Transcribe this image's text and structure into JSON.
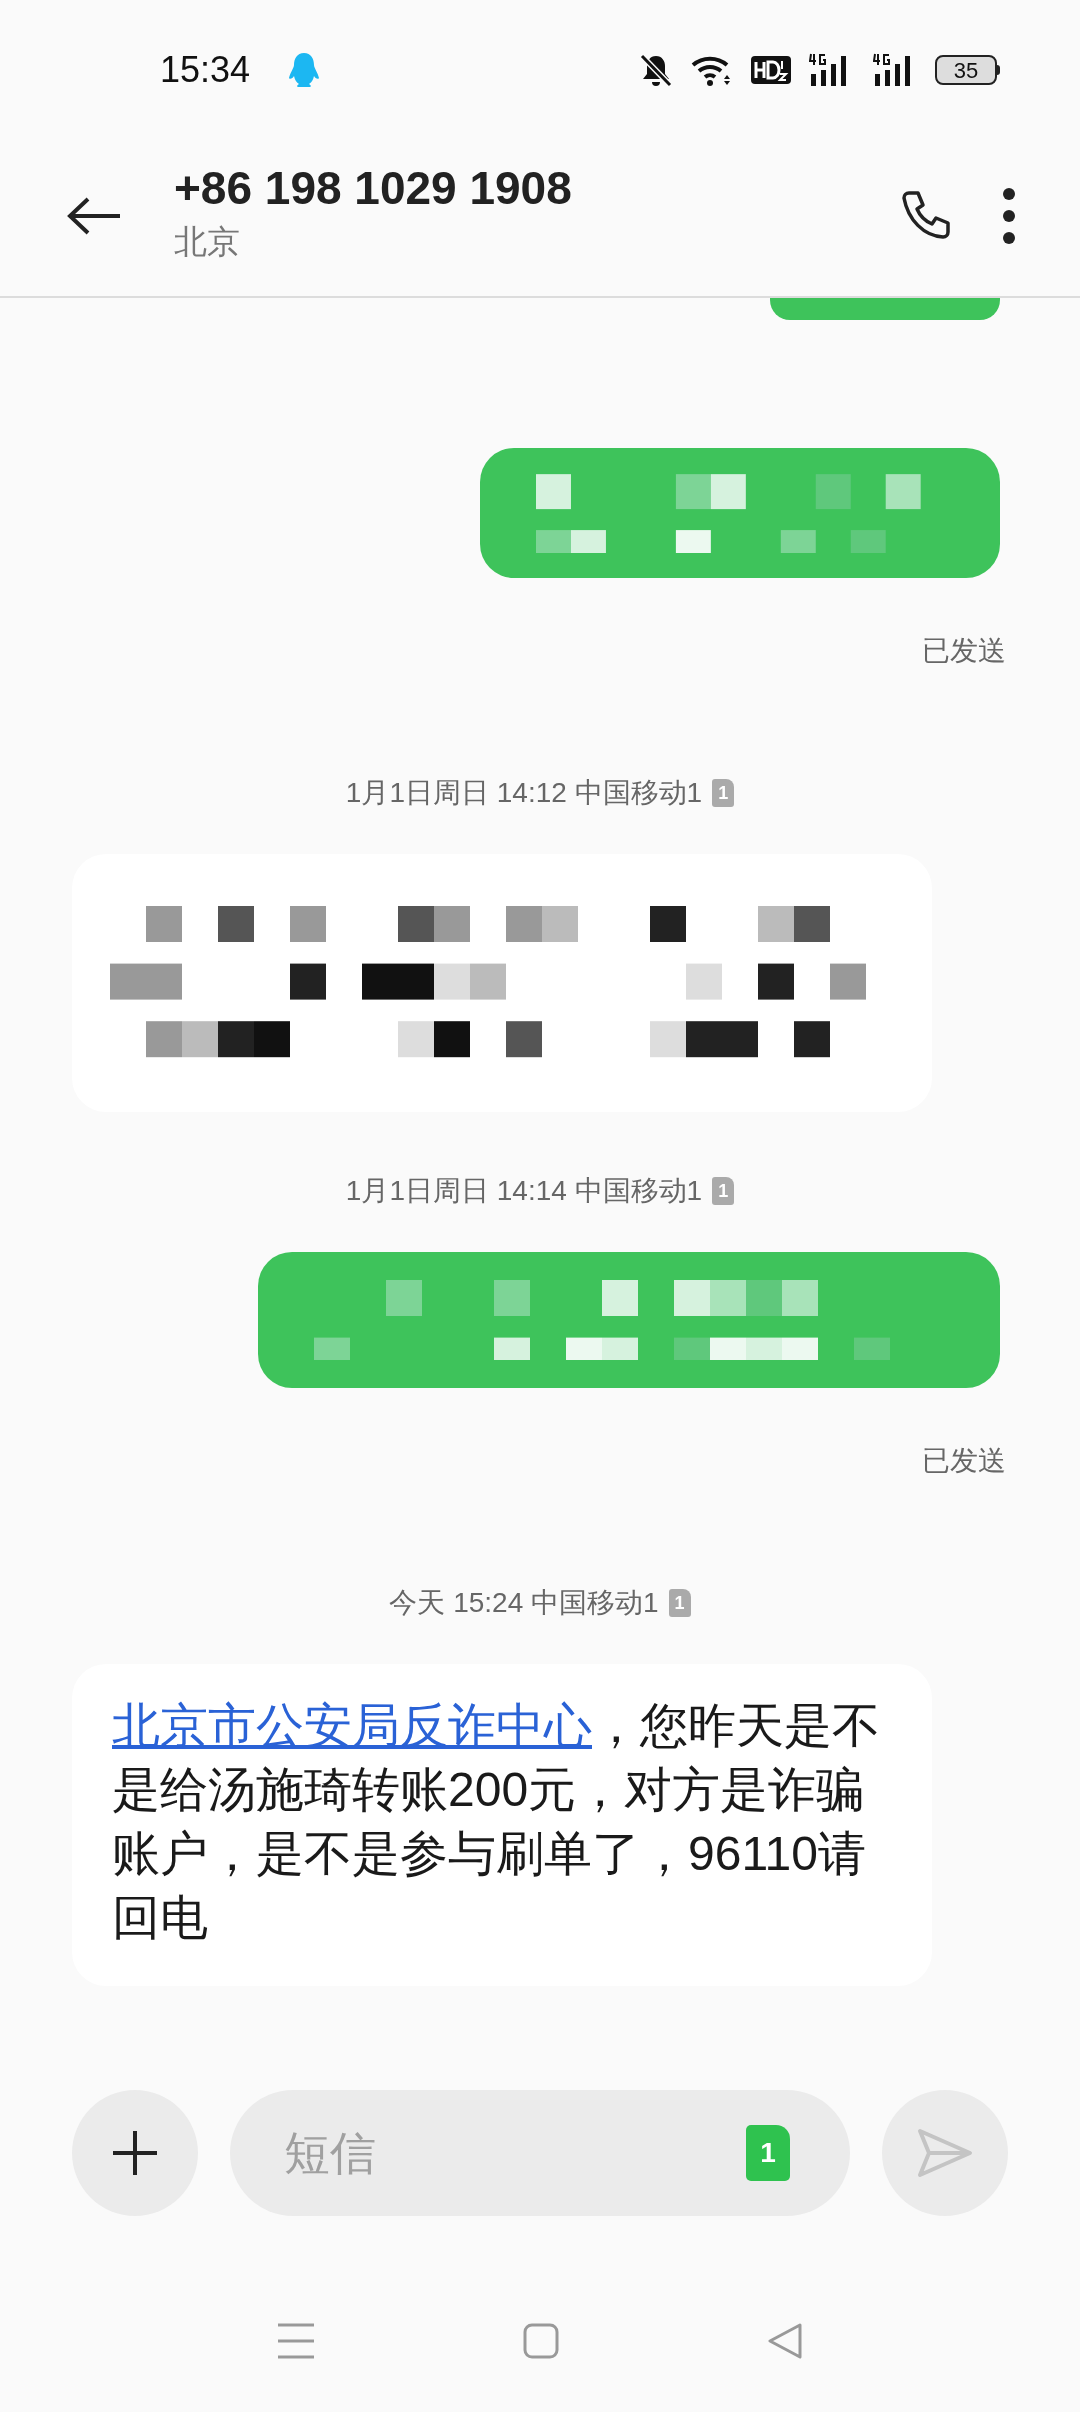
{
  "status_bar": {
    "time": "15:34",
    "battery": "35"
  },
  "header": {
    "title": "+86 198 1029 1908",
    "subtitle": "北京"
  },
  "messages": [
    {
      "kind": "outgoing-partial"
    },
    {
      "kind": "outgoing-redacted",
      "status": "已发送"
    },
    {
      "kind": "timestamp",
      "text": "1月1日周日 14:12 中国移动1",
      "sim": "1"
    },
    {
      "kind": "incoming-redacted"
    },
    {
      "kind": "timestamp",
      "text": "1月1日周日 14:14 中国移动1",
      "sim": "1"
    },
    {
      "kind": "outgoing-redacted",
      "status": "已发送"
    },
    {
      "kind": "timestamp",
      "text": "今天 15:24 中国移动1",
      "sim": "1"
    },
    {
      "kind": "incoming",
      "link": "北京市公安局反诈中心",
      "text": "，您昨天是不是给汤施琦转账200元，对方是诈骗账户，是不是参与刷单了，96110请回电"
    }
  ],
  "composer": {
    "placeholder": "短信",
    "sim": "1"
  }
}
